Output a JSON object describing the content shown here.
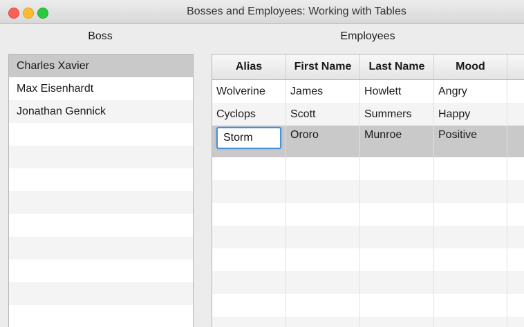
{
  "window": {
    "title": "Bosses and Employees: Working with Tables"
  },
  "boss": {
    "label": "Boss",
    "items": [
      "Charles Xavier",
      "Max Eisenhardt",
      "Jonathan Gennick"
    ],
    "selected_index": 0
  },
  "employees": {
    "label": "Employees",
    "columns": [
      "Alias",
      "First Name",
      "Last Name",
      "Mood"
    ],
    "rows": [
      {
        "alias": "Wolverine",
        "first": "James",
        "last": "Howlett",
        "mood": "Angry"
      },
      {
        "alias": "Cyclops",
        "first": "Scott",
        "last": "Summers",
        "mood": "Happy"
      },
      {
        "alias": "Storm",
        "first": "Ororo",
        "last": "Munroe",
        "mood": "Positive"
      }
    ],
    "selected_index": 2,
    "editing_cell": "alias"
  },
  "colors": {
    "selection": "#c9c9c9",
    "focus": "#4a90d9",
    "close": "#fc5f57",
    "minimize": "#fdbc2e",
    "maximize": "#2ac940"
  }
}
